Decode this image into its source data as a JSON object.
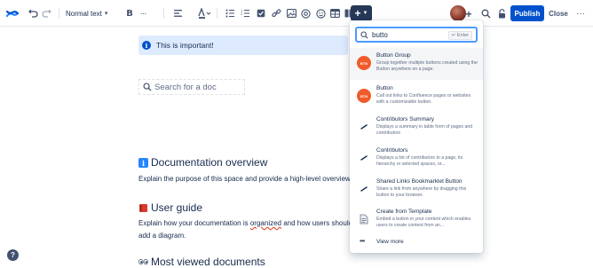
{
  "toolbar": {
    "text_style": "Normal text",
    "bold": "B",
    "more_formatting": "···",
    "insert_label": "+",
    "publish_label": "Publish",
    "close_label": "Close",
    "more_label": "···"
  },
  "editor": {
    "info_panel": "This is important!",
    "search_placeholder": "Search for a doc",
    "sections": [
      {
        "icon": "info-icon",
        "heading": "Documentation overview",
        "body": "Explain the purpose of this space and provide a high-level overview of w"
      },
      {
        "icon": "book-icon",
        "heading": "User guide",
        "body_parts": [
          "Explain how your documentation is ",
          "organized",
          " and how users should nav"
        ],
        "body_line2": "add a diagram."
      },
      {
        "icon": "eyes-icon",
        "heading": "Most viewed documents"
      }
    ]
  },
  "insert_menu": {
    "search_value": "butto",
    "enter_hint": "↵ Enter",
    "items": [
      {
        "icon": "button-macro-icon",
        "title": "Button Group",
        "description": "Group together multiple buttons created using the Button anywhere on a page."
      },
      {
        "icon": "button-macro-icon",
        "title": "Button",
        "description": "Call out links to Confluence pages or websites with a customizable button."
      },
      {
        "icon": "contributors-summary-icon",
        "title": "Contributors Summary",
        "description": "Displays a summary in table form of pages and contributors"
      },
      {
        "icon": "contributors-icon",
        "title": "Contributors",
        "description": "Displays a list of contributors to a page, its hierarchy or selected spaces, or..."
      },
      {
        "icon": "bookmarklet-icon",
        "title": "Shared Links Bookmarklet Button",
        "description": "Share a link from anywhere by dragging this button to your browser."
      },
      {
        "icon": "template-icon",
        "title": "Create from Template",
        "description": "Embed a button in your content which enables users to create content from an..."
      }
    ],
    "view_more": "View more"
  },
  "help": "?",
  "colors": {
    "primary": "#0052cc",
    "insert_bg": "#253858",
    "info_bg": "#deebff",
    "button_macro": "#f15b2a"
  }
}
